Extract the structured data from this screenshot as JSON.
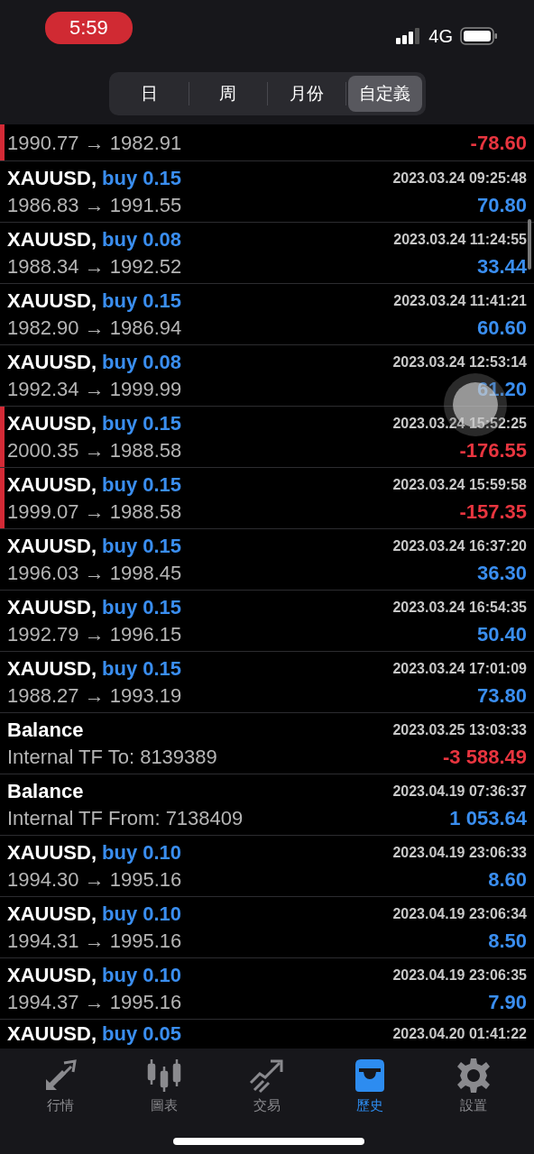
{
  "status_bar": {
    "time": "5:59",
    "network": "4G"
  },
  "segments": [
    {
      "label": "日",
      "selected": false
    },
    {
      "label": "周",
      "selected": false
    },
    {
      "label": "月份",
      "selected": false
    },
    {
      "label": "自定義",
      "selected": true
    }
  ],
  "history": [
    {
      "kind": "partial",
      "flagged": true,
      "color": "#e8353f",
      "prices": "1990.77 → 1982.91",
      "profit": "-78.60"
    },
    {
      "kind": "trade",
      "flagged": false,
      "color": "#3a8ef0",
      "symbol": "XAUUSD,",
      "side": "buy 0.15",
      "time": "2023.03.24 09:25:48",
      "prices": "1986.83 → 1991.55",
      "profit": "70.80"
    },
    {
      "kind": "trade",
      "flagged": false,
      "color": "#3a8ef0",
      "symbol": "XAUUSD,",
      "side": "buy 0.08",
      "time": "2023.03.24 11:24:55",
      "prices": "1988.34 → 1992.52",
      "profit": "33.44"
    },
    {
      "kind": "trade",
      "flagged": false,
      "color": "#3a8ef0",
      "symbol": "XAUUSD,",
      "side": "buy 0.15",
      "time": "2023.03.24 11:41:21",
      "prices": "1982.90 → 1986.94",
      "profit": "60.60"
    },
    {
      "kind": "trade",
      "flagged": false,
      "color": "#3a8ef0",
      "symbol": "XAUUSD,",
      "side": "buy 0.08",
      "time": "2023.03.24 12:53:14",
      "prices": "1992.34 → 1999.99",
      "profit": "61.20"
    },
    {
      "kind": "trade",
      "flagged": true,
      "color": "#e8353f",
      "symbol": "XAUUSD,",
      "side": "buy 0.15",
      "time": "2023.03.24 15:52:25",
      "prices": "2000.35 → 1988.58",
      "profit": "-176.55"
    },
    {
      "kind": "trade",
      "flagged": true,
      "color": "#e8353f",
      "symbol": "XAUUSD,",
      "side": "buy 0.15",
      "time": "2023.03.24 15:59:58",
      "prices": "1999.07 → 1988.58",
      "profit": "-157.35"
    },
    {
      "kind": "trade",
      "flagged": false,
      "color": "#3a8ef0",
      "symbol": "XAUUSD,",
      "side": "buy 0.15",
      "time": "2023.03.24 16:37:20",
      "prices": "1996.03 → 1998.45",
      "profit": "36.30"
    },
    {
      "kind": "trade",
      "flagged": false,
      "color": "#3a8ef0",
      "symbol": "XAUUSD,",
      "side": "buy 0.15",
      "time": "2023.03.24 16:54:35",
      "prices": "1992.79 → 1996.15",
      "profit": "50.40"
    },
    {
      "kind": "trade",
      "flagged": false,
      "color": "#3a8ef0",
      "symbol": "XAUUSD,",
      "side": "buy 0.15",
      "time": "2023.03.24 17:01:09",
      "prices": "1988.27 → 1993.19",
      "profit": "73.80"
    },
    {
      "kind": "balance",
      "flagged": false,
      "color": "#e8353f",
      "symbol": "Balance",
      "time": "2023.03.25 13:03:33",
      "prices": "Internal TF To: 8139389",
      "profit": "-3 588.49"
    },
    {
      "kind": "balance",
      "flagged": false,
      "color": "#3a8ef0",
      "symbol": "Balance",
      "time": "2023.04.19 07:36:37",
      "prices": "Internal TF From: 7138409",
      "profit": "1 053.64"
    },
    {
      "kind": "trade",
      "flagged": false,
      "color": "#3a8ef0",
      "symbol": "XAUUSD,",
      "side": "buy 0.10",
      "time": "2023.04.19 23:06:33",
      "prices": "1994.30 → 1995.16",
      "profit": "8.60"
    },
    {
      "kind": "trade",
      "flagged": false,
      "color": "#3a8ef0",
      "symbol": "XAUUSD,",
      "side": "buy 0.10",
      "time": "2023.04.19 23:06:34",
      "prices": "1994.31 → 1995.16",
      "profit": "8.50"
    },
    {
      "kind": "trade",
      "flagged": false,
      "color": "#3a8ef0",
      "symbol": "XAUUSD,",
      "side": "buy 0.10",
      "time": "2023.04.19 23:06:35",
      "prices": "1994.37 → 1995.16",
      "profit": "7.90"
    },
    {
      "kind": "cut",
      "flagged": false,
      "symbol": "XAUUSD,",
      "side": "buy 0.05",
      "time": "2023.04.20 01:41:22"
    }
  ],
  "tab_bar": [
    {
      "label": "行情",
      "selected": false
    },
    {
      "label": "圖表",
      "selected": false
    },
    {
      "label": "交易",
      "selected": false
    },
    {
      "label": "歷史",
      "selected": true
    },
    {
      "label": "設置",
      "selected": false
    }
  ]
}
